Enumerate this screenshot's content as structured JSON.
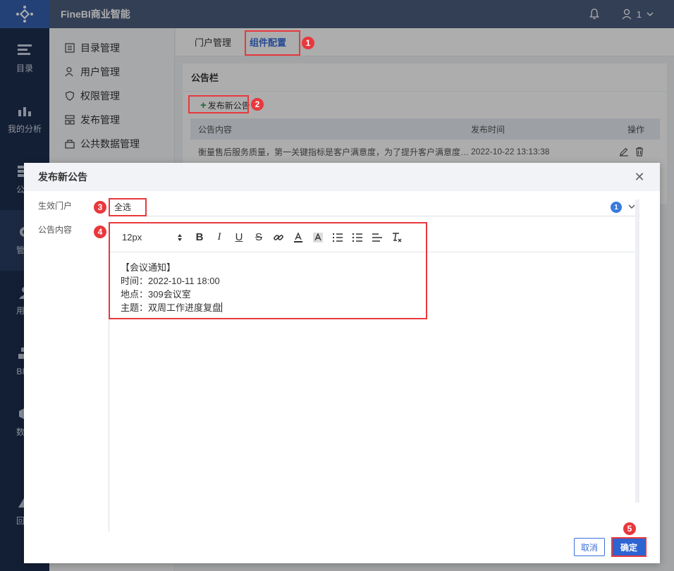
{
  "app": {
    "title": "FineBI商业智能",
    "user": "1"
  },
  "rail": [
    {
      "label": "目录",
      "icon": "catalog-icon"
    },
    {
      "label": "我的分析",
      "icon": "analysis-icon"
    },
    {
      "label": "公共",
      "icon": "public-data-icon"
    },
    {
      "label": "管理",
      "icon": "gear-icon"
    },
    {
      "label": "用户",
      "icon": "user-icon"
    },
    {
      "label": "BI工",
      "icon": "bi-tool-icon"
    },
    {
      "label": "数据",
      "icon": "data-icon"
    },
    {
      "label": "回收",
      "icon": "recycle-icon"
    }
  ],
  "submenu": [
    {
      "label": "目录管理",
      "icon": "catalog-manage-icon"
    },
    {
      "label": "用户管理",
      "icon": "user-manage-icon"
    },
    {
      "label": "权限管理",
      "icon": "shield-icon"
    },
    {
      "label": "发布管理",
      "icon": "publish-icon"
    },
    {
      "label": "公共数据管理",
      "icon": "public-data-manage-icon"
    }
  ],
  "tabs": [
    "门户管理",
    "组件配置"
  ],
  "bulletin": {
    "title": "公告栏",
    "add_label": "发布新公告",
    "columns": [
      "公告内容",
      "发布时间",
      "操作"
    ],
    "rows": [
      {
        "content": "衡量售后服务质量，第一关键指标是客户满意度，为了提升客户满意度…",
        "time": "2022-10-22 13:13:38"
      }
    ]
  },
  "dialog": {
    "title": "发布新公告",
    "portal_label": "生效门户",
    "portal_value": "全选",
    "portal_count": "1",
    "content_label": "公告内容",
    "font_size": "12px",
    "toolbar": [
      "bold",
      "italic",
      "underline",
      "strikethrough",
      "link",
      "font-color",
      "highlight",
      "ordered-list",
      "unordered-list",
      "align",
      "clear-format"
    ],
    "content_lines": [
      "【会议通知】",
      "时间：2022-10-11 18:00",
      "地点：309会议室",
      "主题：双周工作进度复盘"
    ],
    "cancel_label": "取消",
    "ok_label": "确定"
  },
  "annotations": [
    "1",
    "2",
    "3",
    "4",
    "5"
  ],
  "colors": {
    "accent": "#3a6fd8",
    "rail": "#1d2e4f",
    "topbar": "#4c5d7d",
    "annotation": "#e8383d",
    "primary_button": "#2d64d2"
  }
}
